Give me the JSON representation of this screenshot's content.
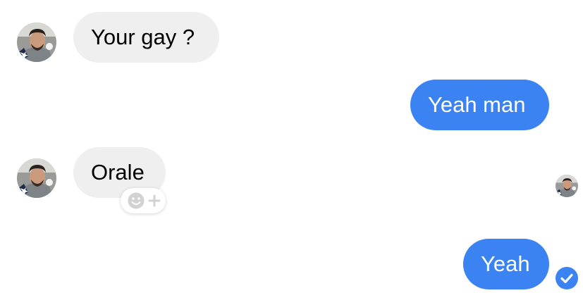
{
  "conversation": {
    "messages": [
      {
        "sender": "contact",
        "text": "Your gay ?"
      },
      {
        "sender": "me",
        "text": "Yeah man"
      },
      {
        "sender": "contact",
        "text": "Orale"
      },
      {
        "sender": "me",
        "text": "Yeah"
      }
    ]
  },
  "colors": {
    "outgoing_bubble": "#3b82f2",
    "incoming_bubble": "#efefef",
    "delivered_check": "#3b82f2"
  },
  "icons": {
    "reaction": "add-reaction-icon",
    "read_receipt": "seen-avatar",
    "delivered": "check-circle-icon"
  }
}
